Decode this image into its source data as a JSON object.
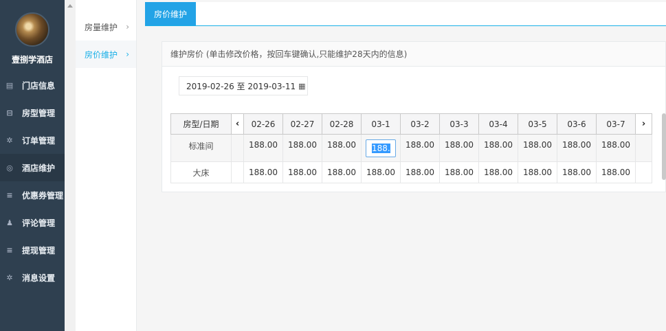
{
  "sidebar": {
    "brand_name": "壹捌学酒店",
    "items": [
      {
        "label": "门店信息",
        "icon": "newspaper-icon",
        "glyph": "▤",
        "active": false
      },
      {
        "label": "房型管理",
        "icon": "cart-icon",
        "glyph": "⊟",
        "active": false
      },
      {
        "label": "订单管理",
        "icon": "gear-icon",
        "glyph": "✲",
        "active": false
      },
      {
        "label": "酒店维护",
        "icon": "target-icon",
        "glyph": "◎",
        "active": true
      },
      {
        "label": "优惠券管理",
        "icon": "list-icon",
        "glyph": "≡",
        "active": false
      },
      {
        "label": "评论管理",
        "icon": "user-icon",
        "glyph": "♟",
        "active": false
      },
      {
        "label": "提现管理",
        "icon": "list-icon",
        "glyph": "≡",
        "active": false
      },
      {
        "label": "消息设置",
        "icon": "gear-icon",
        "glyph": "✲",
        "active": false
      }
    ]
  },
  "submenu": {
    "items": [
      {
        "label": "房量维护",
        "active": false
      },
      {
        "label": "房价维护",
        "active": true
      }
    ]
  },
  "tabs": [
    {
      "label": "房价维护",
      "active": true
    }
  ],
  "panel": {
    "title": "维护房价 (单击修改价格，按回车键确认,只能维护28天内的信息)",
    "date_range": "2019-02-26 至 2019-03-11"
  },
  "grid": {
    "header_label": "房型/日期",
    "dates": [
      "02-26",
      "02-27",
      "02-28",
      "03-1",
      "03-2",
      "03-3",
      "03-4",
      "03-5",
      "03-6",
      "03-7"
    ],
    "rows": [
      {
        "room_type": "标准间",
        "prices": [
          "188.00",
          "188.00",
          "188.00",
          "188.",
          "188.00",
          "188.00",
          "188.00",
          "188.00",
          "188.00",
          "188.00"
        ],
        "editing_index": 3
      },
      {
        "room_type": "大床",
        "prices": [
          "188.00",
          "188.00",
          "188.00",
          "188.00",
          "188.00",
          "188.00",
          "188.00",
          "188.00",
          "188.00",
          "188.00"
        ],
        "editing_index": -1
      }
    ]
  },
  "colors": {
    "sidebar_bg": "#2f4050",
    "accent": "#1ab0e8",
    "tab_bg": "#23a3e6"
  }
}
